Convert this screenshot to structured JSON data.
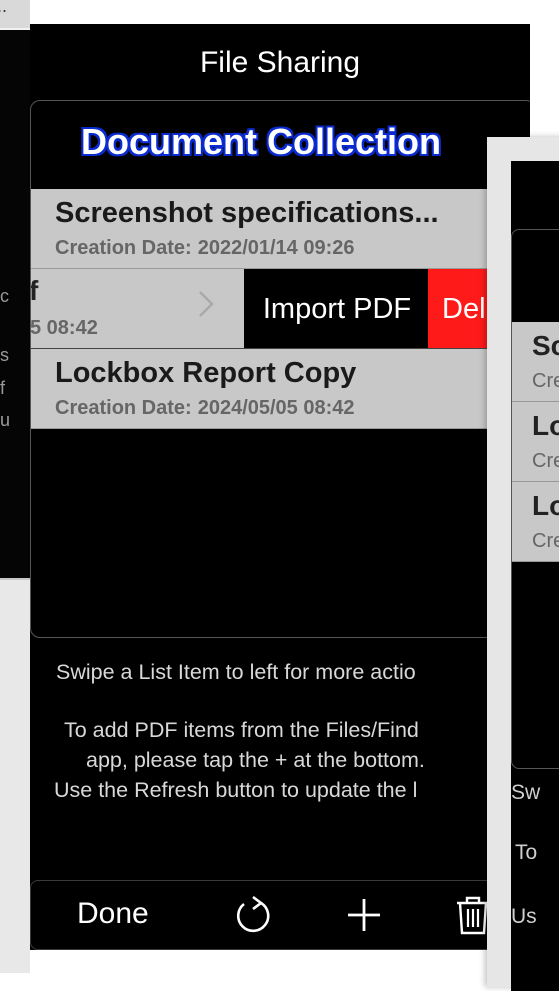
{
  "nav": {
    "title": "File Sharing"
  },
  "list": {
    "title": "Document Collection",
    "date_label": "Creation Date:",
    "items": [
      {
        "name": "Screenshot specifications...",
        "date": "2022/01/14 09:26"
      },
      {
        "name": "f",
        "date": "5 08:42"
      },
      {
        "name": "Lockbox Report Copy",
        "date": "2024/05/05 08:42"
      }
    ],
    "swipe_actions": {
      "import": "Import PDF",
      "delete": "Del"
    }
  },
  "info": {
    "line1": "Swipe a List Item to left for more actio",
    "line2": "To add PDF items from the Files/Find",
    "line3": "app, please tap the + at the bottom.",
    "line4": "Use the Refresh button to update the l"
  },
  "toolbar": {
    "done": "Done",
    "icons": [
      "refresh-icon",
      "plus-icon",
      "trash-icon"
    ]
  },
  "background_left": {
    "top": "...",
    "fragments": [
      "c",
      "s",
      "f",
      "u"
    ]
  },
  "background_right": {
    "rows": [
      {
        "name": "Sc",
        "sub": "Cre"
      },
      {
        "name": "Lo",
        "sub": "Cre"
      },
      {
        "name": "Lo",
        "sub": "Cre"
      }
    ],
    "lines": [
      "Sw",
      "To",
      "Us"
    ]
  },
  "colors": {
    "title_outline": "#0a2bd0",
    "delete": "#ff1a1a",
    "row_bg": "#c8c8c8"
  }
}
